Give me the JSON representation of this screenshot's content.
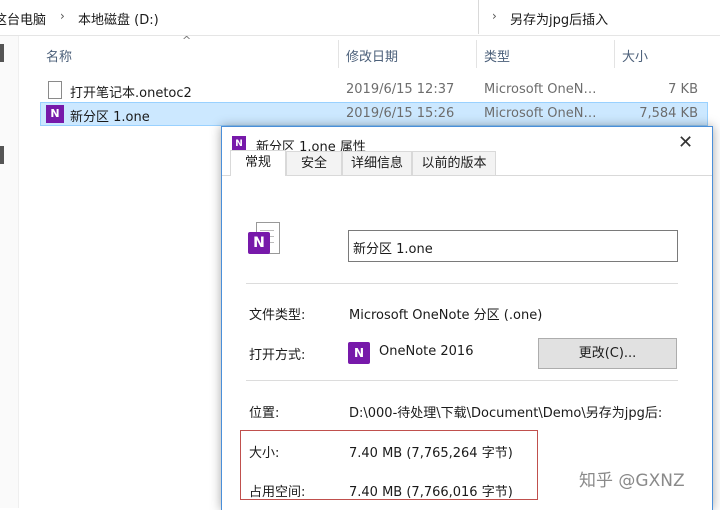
{
  "address": {
    "crumbs": [
      "这台电脑",
      "本地磁盘 (D:)"
    ],
    "search_text": "另存为jpg后插入"
  },
  "columns": {
    "name": "名称",
    "modified": "修改日期",
    "type": "类型",
    "size": "大小"
  },
  "files": [
    {
      "name": "打开笔记本.onetoc2",
      "modified": "2019/6/15 12:37",
      "type": "Microsoft OneN…",
      "size": "7 KB",
      "icon": "document-icon"
    },
    {
      "name": "新分区 1.one",
      "modified": "2019/6/15 15:26",
      "type": "Microsoft OneN…",
      "size": "7,584 KB",
      "icon": "onenote-file-icon"
    }
  ],
  "dialog": {
    "title": "新分区 1.one 属性",
    "tabs": [
      "常规",
      "安全",
      "详细信息",
      "以前的版本"
    ],
    "active_tab": "常规",
    "filename_value": "新分区 1.one",
    "file_type_label": "文件类型:",
    "file_type_value": "Microsoft OneNote 分区 (.one)",
    "opens_with_label": "打开方式:",
    "opens_with_value": "OneNote 2016",
    "change_button": "更改(C)...",
    "location_label": "位置:",
    "location_value": "D:\\000-待处理\\下载\\Document\\Demo\\另存为jpg后:",
    "size_label": "大小:",
    "size_value": "7.40 MB (7,765,264 字节)",
    "size_on_disk_label": "占用空间:",
    "size_on_disk_value": "7.40 MB (7,766,016 字节)",
    "highlight_color": "#c0504d"
  },
  "watermark": "知乎 @GXNZ"
}
